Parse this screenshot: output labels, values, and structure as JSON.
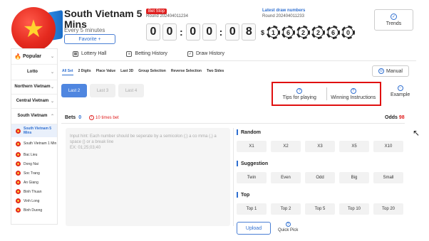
{
  "header": {
    "title": "South Vietnam 5 Mins",
    "subtitle": "Every 5 minutes",
    "favorite_label": "Favorite +",
    "bet_stop": "Bet Stop",
    "current_round": "Round 202404011234",
    "timer": [
      "0",
      "0",
      "0",
      "0",
      "0",
      "8"
    ],
    "latest_title": "Latest draw numbers",
    "previous_round": "Round 202404011233",
    "currency_symbol": "$",
    "results": [
      "1",
      "6",
      "2",
      "2",
      "6",
      "0"
    ],
    "trends_label": "Trends"
  },
  "sidebar": {
    "popular_label": "Popular",
    "lotto_label": "Lotto",
    "groups": [
      {
        "label": "Northern Vietnam"
      },
      {
        "label": "Central Vietnam"
      },
      {
        "label": "South Vietnam"
      }
    ],
    "items": [
      {
        "label": "South Vietnam 5 Mins",
        "active": true
      },
      {
        "label": "South Vietnam 1 Min",
        "active": false
      },
      {
        "label": "Bac Lieu",
        "active": false
      },
      {
        "label": "Dong Nai",
        "active": false
      },
      {
        "label": "Soc Trang",
        "active": false
      },
      {
        "label": "An Giang",
        "active": false
      },
      {
        "label": "Binh Thuan",
        "active": false
      },
      {
        "label": "Vinh Long",
        "active": false
      },
      {
        "label": "Binh Duong",
        "active": false
      }
    ]
  },
  "nav": {
    "lottery_hall": "Lottery Hall",
    "betting_history": "Betting History",
    "draw_history": "Draw History"
  },
  "play_tabs": [
    "All Set",
    "2 Digits",
    "Place Value",
    "Last 3D",
    "Group Selection",
    "Reverse Selection",
    "Two Sides"
  ],
  "manual_label": "Manual",
  "sub_tabs": [
    "Last 2",
    "Last 3",
    "Last 4"
  ],
  "tips": {
    "tips_label": "Tips for playing",
    "winning_label": "Winning Instructions",
    "example_label": "Example"
  },
  "bets": {
    "label": "Bets",
    "count": "0",
    "times_bet": "10 times bet",
    "odds_label": "Odds",
    "odds_value": "98"
  },
  "input_hint": "Input hint: Each number should be seperate by a semicolon (;) a co mma (,) a space () or a break line",
  "input_example": "EX: 01;25;03;40",
  "panel": {
    "random_title": "Random",
    "random_opts": [
      "X1",
      "X2",
      "X3",
      "X5",
      "X10"
    ],
    "suggestion_title": "Suggestion",
    "suggestion_opts": [
      "Twin",
      "Even",
      "Odd",
      "Big",
      "Small"
    ],
    "top_title": "Top",
    "top_opts": [
      "Top 1",
      "Top 2",
      "Top 5",
      "Top 10",
      "Top 20"
    ],
    "upload_label": "Upload",
    "quickpick_label": "Quick Pick"
  },
  "colors": {
    "accent": "#2f6fd0",
    "alert": "#e02020",
    "highlight_box": "#e01010"
  }
}
